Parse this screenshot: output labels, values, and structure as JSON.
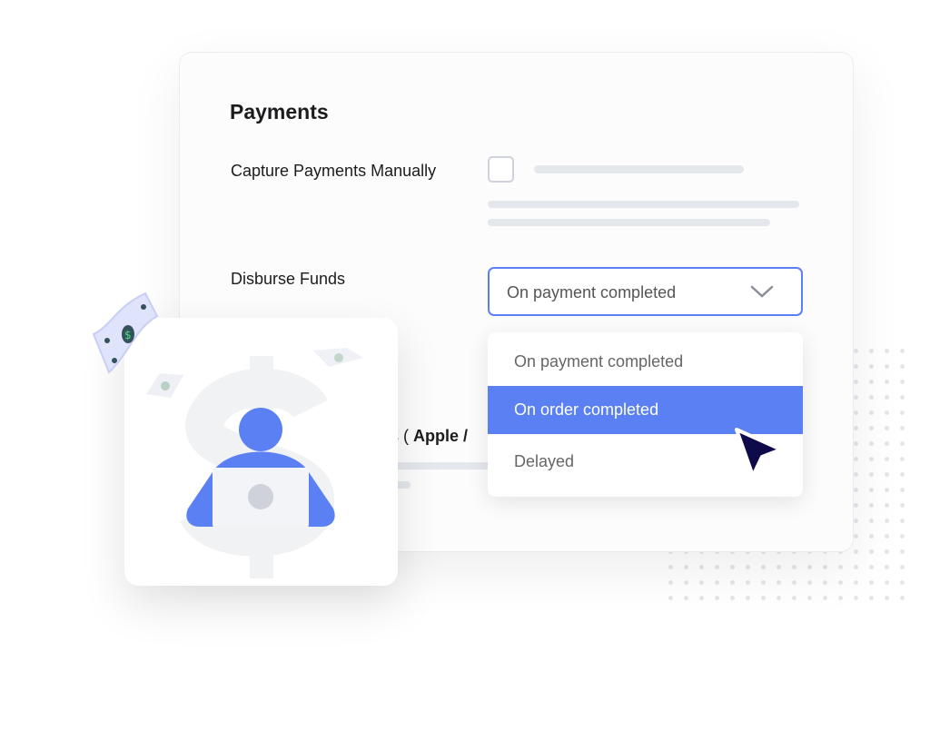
{
  "payments": {
    "title": "Payments",
    "capture_label": "Capture Payments Manually",
    "capture_checked": false,
    "disburse_label": "Disburse Funds",
    "disburse_selected": "On payment completed",
    "options": [
      "On payment completed",
      "On order completed",
      "Delayed"
    ],
    "highlighted_option": "On order completed",
    "partial_label_prefix": "ons ( ",
    "partial_label_bold": "Apple /"
  },
  "colors": {
    "accent": "#5a80f3",
    "cursor": "#0f0b4a",
    "skeleton": "#e4e7ec"
  },
  "icons": {
    "dropdown": "chevron-down-icon",
    "pointer": "cursor-arrow-icon",
    "illustration": "person-laptop-dollar-icon",
    "decor": "money-bill-icon"
  }
}
